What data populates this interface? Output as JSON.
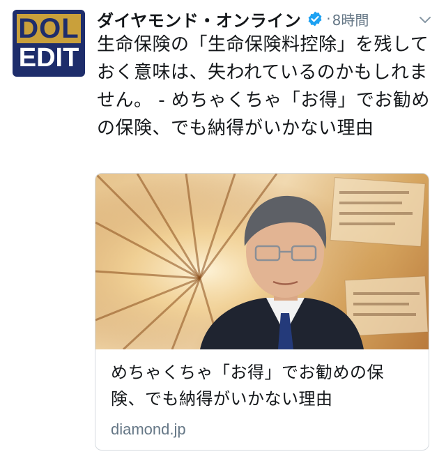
{
  "account": {
    "display_name": "ダイヤモンド・オンライン",
    "avatar": {
      "line1": "DOL",
      "line2": "EDIT"
    },
    "verified": true,
    "separator": "·",
    "time": "8時間"
  },
  "tweet": {
    "text": "生命保険の「生命保険料控除」を残しておく意味は、失われているのかもしれません。 - めちゃくちゃ「お得」でお勧めの保険、でも納得がいかない理由"
  },
  "card": {
    "title": "めちゃくちゃ「お得」でお勧めの保険、でも納得がいかない理由",
    "domain": "diamond.jp"
  },
  "colors": {
    "accent": "#1da1f2",
    "secondary_text": "#657786",
    "logo_navy": "#1e2d6b",
    "logo_gold": "#c9a03b"
  },
  "icons": [
    "verified-icon",
    "chevron-down-icon"
  ]
}
